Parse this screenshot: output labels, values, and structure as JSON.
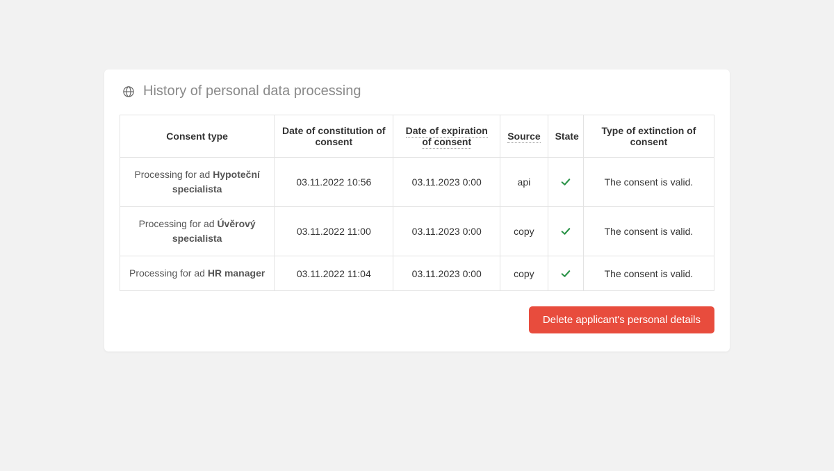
{
  "panel": {
    "title": "History of personal data processing"
  },
  "table": {
    "headers": {
      "consentType": "Consent type",
      "dateConstitution": "Date of constitution of consent",
      "dateExpiration": "Date of expiration of consent",
      "source": "Source",
      "state": "State",
      "extinction": "Type of extinction of consent"
    },
    "rows": [
      {
        "consentPrefix": "Processing for ad ",
        "consentBold": "Hypoteční specialista",
        "dateConstitution": "03.11.2022 10:56",
        "dateExpiration": "03.11.2023 0:00",
        "source": "api",
        "stateValid": true,
        "extinction": "The consent is valid."
      },
      {
        "consentPrefix": "Processing for ad ",
        "consentBold": "Úvěrový specialista",
        "dateConstitution": "03.11.2022 11:00",
        "dateExpiration": "03.11.2023 0:00",
        "source": "copy",
        "stateValid": true,
        "extinction": "The consent is valid."
      },
      {
        "consentPrefix": "Processing for ad ",
        "consentBold": "HR manager",
        "dateConstitution": "03.11.2022 11:04",
        "dateExpiration": "03.11.2023 0:00",
        "source": "copy",
        "stateValid": true,
        "extinction": "The consent is valid."
      }
    ]
  },
  "actions": {
    "deleteLabel": "Delete applicant's personal details"
  },
  "colors": {
    "danger": "#e84c3d",
    "success": "#2b9348"
  }
}
